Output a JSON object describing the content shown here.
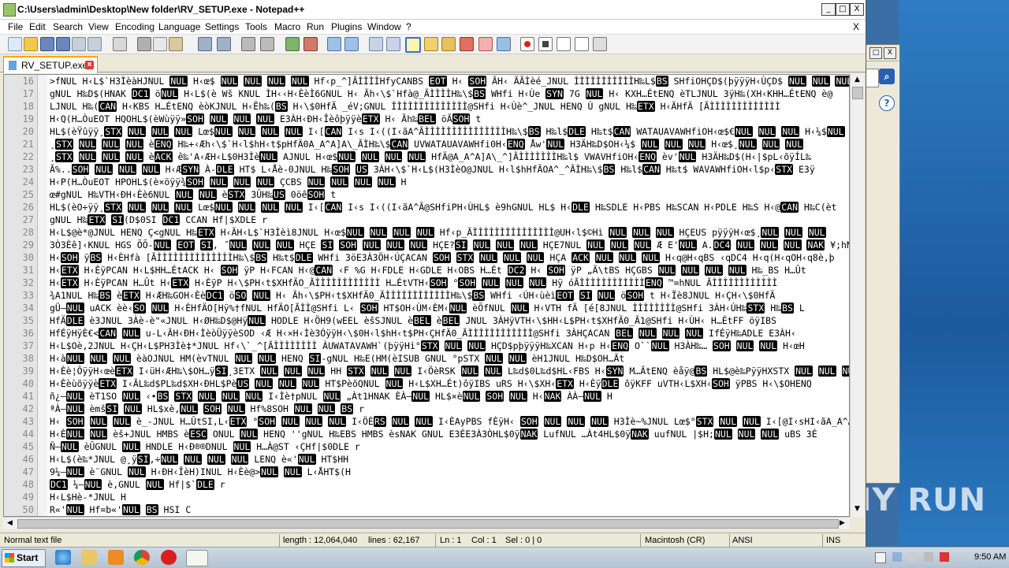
{
  "window": {
    "title": "C:\\Users\\admin\\Desktop\\New folder\\RV_SETUP.exe - Notepad++",
    "minimize_glyph": "_",
    "maximize_glyph": "□",
    "close_glyph": "X"
  },
  "menu": [
    "File",
    "Edit",
    "Search",
    "View",
    "Encoding",
    "Language",
    "Settings",
    "Tools",
    "Macro",
    "Run",
    "Plugins",
    "Window",
    "?"
  ],
  "menu_close_doc": "X",
  "tab": {
    "name": "RV_SETUP.exe",
    "close_glyph": "x"
  },
  "editor": {
    "lines": [
      {
        "n": "16",
        "text": ">fNUL H‹L$`H3ÌèàHJNUL NUL H‹œ$  NUL NUL NUL NUL Hf‹p_^]ÃÌÌÌÌHfyCANBS EOT H‹ SOH ÃH‹ ÃÃÌèé_JNUL ÌÌÌÌÌÌÌÌÌÌÌH‰L$BS SHfiOHÇD$(þÿÿÿH‹ÙÇD$  NUL NUL NUL"
      },
      {
        "n": "17",
        "text": "gNUL H‰D$(HNAK DC1 öNUL H‹L$(è Wš KNUL ÌH‹‹H‹ÈèÌ6GNUL H‹ Ãh‹\\$`Hfà@_ÃÌÌÌÌH‰\\$BS WHfi H‹Ùe SYN 7G NUL H‹ KXH…ÉtENQ èTLJNUL 3ÿH‰(XH‹KHH…ÉtENQ è@"
      },
      {
        "n": "18",
        "text": "LJNUL H‰(CAN H‹KBS H…ÉtENQ èòKJNUL H‹Ëh‰(BS H‹\\$0HfÄ _éV;GNUL ÌÌÌÌÌÌÌÌÌÌÌÌÌÌ@SHfi H‹Ùè^_JNUL HENQ Ù   gNUL H‰ETX H‹ÃHfÄ [ÃÌÌÌÌÌÌÌÌÌÌÌÌÌ"
      },
      {
        "n": "19",
        "text": "H‹Q(H…ÒuEOT HQOHL$(èWùÿÿ»SOH NUL NUL NUL E3ÀH‹ÐH‹ÎèôþÿÿèETX H‹ Ãh‰BEL öÃSOH t"
      },
      {
        "n": "20",
        "text": "HL$(èŸûÿÿ¸STX NUL NUL NUL Lœ$NUL NUL NUL NUL I‹[CAN I‹s I‹((I‹ãA^ÃÌÌÌÌÌÌÌÌÌÌÌÌÌÌÌH‰\\$BS H‰l$DLE H‰t$CAN WATAUAVAWHfiOH‹œ$€NUL NUL NUL H‹¼$NUL"
      },
      {
        "n": "21",
        "text": "¸STX NUL NUL NUL èENQ H‰+‹Æh‹\\$`H‹l$hH‹t$pHfÄ0A_A^A]A\\_ÃÌH‰\\$CAN UVWATAUAVAWHfi0H‹ENQ Åw'NUL H3ÄH‰D$OH‹¼$  NUL NUL NUL H‹œ$¸NUL NUL NUL"
      },
      {
        "n": "22",
        "text": "¸STX NUL NUL NUL èACK ê‰'A‹ÆH‹L$0H3ÌèNUL AJNUL H‹œ$NUL NUL NUL NUL HfÄ@A_A^A]A\\_^]ÃÌÌÌÌÌÌÌH‰l$ VWAVHfiOH‹ENQ èv'NUL H3ÄH‰D$(H‹|$pL‹õÿÍL‰"
      },
      {
        "n": "23",
        "text": "Ã%..SOH NUL NUL NUL H‹ÆSYN À-DLE HT$ L‹Åè-0JNUL H‰SOH US 3ÀH‹\\$`H‹L$(H3ÌèO@JNUL H‹l$hHfÄOA^_^ÃÌH‰\\$BS H‰l$CAN H‰t$ WAVAWHfiOH‹l$p‹STX E3ÿ"
      },
      {
        "n": "24",
        "text": "H‹P(H…ÒuEOT HPOHL$(è×öÿÿ¾SOH NUL NUL NUL ÇCBS NUL NUL NUL NUL H"
      },
      {
        "n": "25",
        "text": "œ#gNUL H‰VTH‹ÐH‹Èè6NUL NUL NUL èSTX 3ÛH‰US 0öêSOH t"
      },
      {
        "n": "26",
        "text": "HL$(èO÷ÿÿ¸STX NUL NUL NUL Lœ$NUL NUL NUL NUL I‹[CAN I‹s I‹((I‹ãA^Ã@SHfiPH‹ÙHL$ è9hGNUL HL$ H‹DLE H‰SDLE H‹PBS H‰SCAN H‹PDLE H‰S H‹@CAN H‰C(èt"
      },
      {
        "n": "27",
        "text": "gNUL H‰ETX SI(D$0SI DC1 CCAN Hf|$XDLE r"
      },
      {
        "n": "28",
        "text": "H‹L$@è*@JNUL HENQ Ç<gNUL H‰ETX H‹ÃH‹L$`H3Ìèì8JNUL H‹œ$NUL NUL NUL NUL Hf‹p_ÃÌÌÌÌÌÌÌÌÌÌÌÌÌÌÌ@UH‹l$©Hì  NUL NUL NUL HÇEUS pÿÿÿH‹œ$¸NUL NUL NUL"
      },
      {
        "n": "29",
        "text": "3Ò3Èê]‹KNUL HGS ÕÕ-NUL  EOT SI, ˝NUL NUL NUL HÇE SI SOH NUL NUL NUL HÇE?SI NUL NUL NUL HÇE7NUL NUL NUL NUL Æ E'NUL A.DC4 NUL NUL NUL NAK ¥;hNUL HM"
      },
      {
        "n": "30",
        "text": "H‹SOH ÿBS H‹ÈHfà [ÃÌÌÌÌÌÌÌÌÌÌÌÌÌÌH‰\\$BS H‰t$DLE WHfi 3öE3À3ÖH‹ÚÇACAN SOH STX NUL NUL NUL HÇA  ACK NUL NUL NUL H‹q@H‹qBS ‹qDC4 H‹q(H‹qOH‹q8è,þ"
      },
      {
        "n": "31",
        "text": "H‹ETX H‹ÈÿPCAN H‹L$HH…ÉtACK H‹ SOH ÿP H‹FCAN H‹@CAN ‹F %G H‹FDLE H‹GDLE H‹OBS H…Ét DC2 H‹ SOH ÿP „Ã\\tBS HÇGBS NUL NUL NUL NUL H‰_BS H…Ût"
      },
      {
        "n": "32",
        "text": "H‹ETX H‹ÈÿPCAN H…Ût  H‹ETX H‹ÈÿP H‹\\$PH‹t$XHfÄO_ÃÌÌÌÌÌÌÌÌÌÌÌÌ   H…ÉtVTH‹SOH °SOH NUL NUL NUL Hÿ óÃÌÌÌÌÌÌÌÌÌÌÌÌENQ ™=hNUL ÃÌÌÌÌÌÌÌÌÌÌÌÌ"
      },
      {
        "n": "33",
        "text": "¾A1NUL H‰BS èETX H‹ÆH‰GOH‹ÈèDC1 öSO NUL H‹ Ãh‹\\$PH‹t$XHfÄ0_ÃÌÌÌÌÌÌÌÌÌÌÌÌH‰\\$BS WHfi ‹ÚH‹ùèìEOT SI NUL öSOH t H‹Ïè8JNUL H‹ÇH‹\\$0HfÄ"
      },
      {
        "n": "34",
        "text": "gÜ—NUL uACK èè‹SO NUL H‹ÈHfÄO[Hÿ%†fNUL HfÄO[ÃÌÌ@SHfi L‹ SOH HT$OH‹ÙM‹ÈM‹NUL èÕfNUL NUL H‹VTH fÄ [é[8JNUL ÌÌÌÌÌÌÌÌ@SHfi 3ÀH‹ÚH‰STX H‰BS L"
      },
      {
        "n": "35",
        "text": "HfÄDLE è3JNUL 3Àè-è\"«JNUL H‹ØH‰D$@HÿNUL HODLE H‹ÖH9(wEEL èšSJNUL èBEL èBEL JNUL 3ÀHÿVTH‹\\$HH‹L$PH‹t$XHfÄ0_Ã1@SHfi H‹ÙH‹   H…ÉtFF öÿIBS"
      },
      {
        "n": "36",
        "text": "HfÉÿHÿÈ€<CAN NUL u-L‹ÃH‹ÐH‹ÌèòÜÿÿèSOD ‹Æ H‹×H‹Ìè3ÓÿÿH‹\\$0H‹l$hH‹t$PH‹ÇHfÄ0_ÃÌÌÌÌÌÌÌÌÌÌÌÌ@SHfi 3ÀHÇACAN BEL NUL NUL NUL IfÉÿH‰ADLE E3ÀH‹"
      },
      {
        "n": "37",
        "text": "H‹L$Oè,2JNUL H‹ÇH‹L$PH3Ìè‡*JNUL Hf‹\\`_^[ÃÌÌÌÌÌÌÌÌ ÀUWATAVAWH`(þÿÿHi°STX NUL NUL HÇD$pþÿÿÿH‰XCAN H‹p H‹ENQ O``NUL H3ÀH‰…  SOH NUL NUL H‹œH"
      },
      {
        "n": "38",
        "text": "H‹àNUL NUL NUL èàOJNUL HM(èvTNUL NUL NUL HENQ SI-gNUL H‰E(HM(èISUB GNUL °pSTX NUL NUL èH1JNUL H‰D$OH…Ãt"
      },
      {
        "n": "39",
        "text": "H‹Èè¦ÔÿÿH‹œèETX I‹üH‹ÆH‰\\$OH…ÿSI¸3ETX NUL NUL NUL HH STX NUL NUL I‹ÖèRSK NUL NUL L‰d$0L‰d$HL‹FBS H‹SYN M…ÃtENQ èåÿ@BS HL$@è‰PÿÿHXSTX NUL NUL NUL"
      },
      {
        "n": "40",
        "text": "H‹ÈèùõÿÿèETX I‹ÃL‰d$PL‰d$XH‹ÐHL$PèUS  NUL NUL NUL HT$PèõQNUL NUL H‹L$XH…Ét)ôÿIBS uRS H‹\\$XH‹ETX H‹ÈÿDLE ôÿKFF uVTH‹L$XH‹SOH ÿPBS H‹\\$OHENQ"
      },
      {
        "n": "41",
        "text": "ñ¿–NUL èT1SO NUL ‹•BS STX NUL NUL NUL I‹Ìè†pNUL NUL „Àt1HNAK ÈÀ–NUL HL$×èNUL SOH NUL H‹NAK ÀÀ–NUL H"
      },
      {
        "n": "42",
        "text": "ªÀ–NUL èmšSI NUL HL$xè,NUL SOH NUL Hf%8SOH NUL NUL BS r"
      },
      {
        "n": "43",
        "text": "H‹ SOH NUL NUL è_-JNUL H…ÛtSI,L‹ETX °SOH NUL NUL NUL I‹ÖÈRS NUL NUL I‹ÈAyPBS fÈÿH‹  SOH NUL NUL NUL H3Ìè~%JNUL Lœ$°STX NUL NUL I‹[@I‹sHI‹ãA_A^A\\_]ÃÌÌÌÌÌ@SH;"
      },
      {
        "n": "44",
        "text": "H‹ÈNUL NUL èš+JNUL HMBS èESC ONUL NUL HENQ ''gNUL H‰EBS HMBS èsNAK GNUL E3ÉE3À3ÒHL$0ÿNAK LufNUL …Àt4HL$0ÿNAK uufNUL |$H;NUL NUL NUL uBS 3É"
      },
      {
        "n": "45",
        "text": "Ñ–NUL èÛGNUL NUL HNDLE H‹Ð®®DNUL NUL H…À@ST ‹ÇHf|$0DLE r"
      },
      {
        "n": "46",
        "text": "H‹L$(è‰*JNUL @¸ÿSI,÷NUL NUL NUL NUL LENQ è«'NUL HT$HH"
      },
      {
        "n": "47",
        "text": "9¼–NUL è¨GNUL NUL H‹ÐH‹ÎèH)INUL H‹Èè@>NUL NUL L‹ÅHT$(H"
      },
      {
        "n": "48",
        "text": "DC1 ¼–NUL è,GNUL NUL Hf|$`DLE r"
      },
      {
        "n": "49",
        "text": "H‹L$Hè-*JNUL H"
      },
      {
        "n": "50",
        "text": "R«'NUL Hf=b«'NUL BS HSI C"
      }
    ]
  },
  "statusbar": {
    "type": "Normal text file",
    "length": "length : 12,064,040",
    "lines": "lines : 62,167",
    "ln": "Ln : 1",
    "col": "Col : 1",
    "sel": "Sel : 0 | 0",
    "eol": "Macintosh (CR)",
    "encoding": "ANSI",
    "mode": "INS"
  },
  "taskbar": {
    "start": "Start",
    "clock": "9:50 AM"
  },
  "watermark": "ANY RUN",
  "colors": {
    "control_char_bg": "#000000",
    "control_char_fg": "#ffffff",
    "tab_accent": "#f9a800"
  }
}
